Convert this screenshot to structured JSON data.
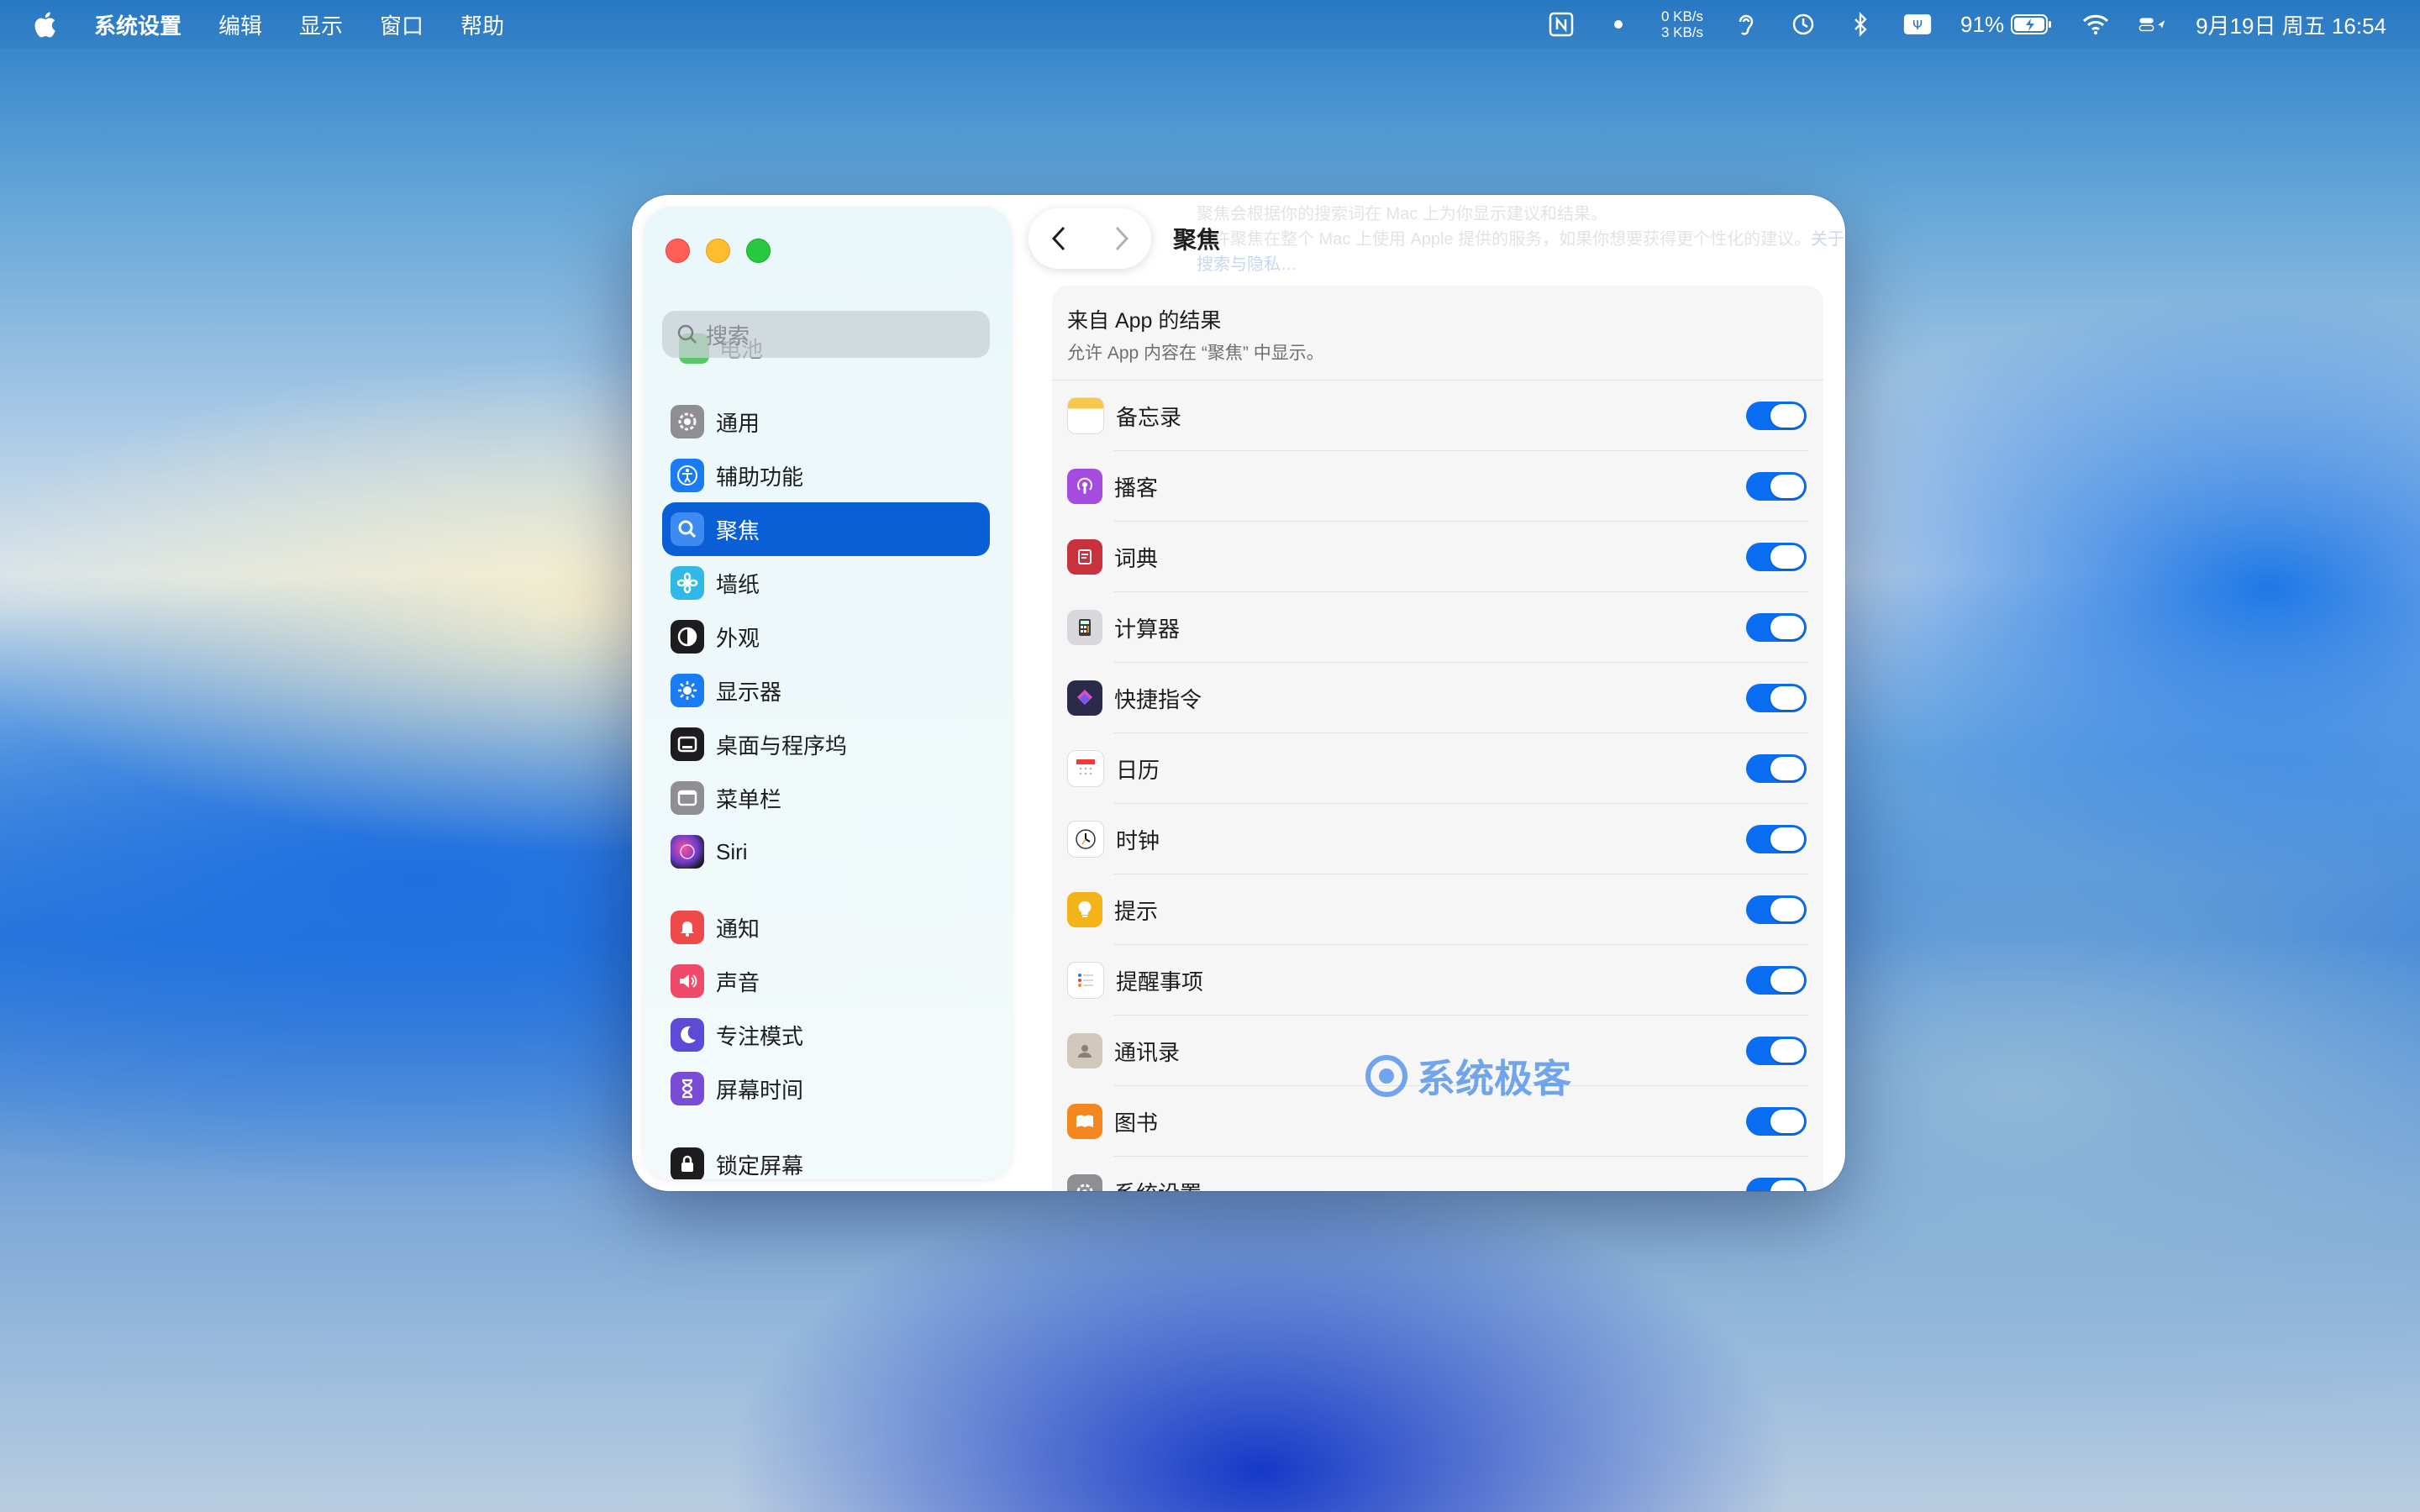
{
  "menubar": {
    "app_name": "系统设置",
    "menus": [
      "编辑",
      "显示",
      "窗口",
      "帮助"
    ],
    "net_down": "0 KB/s",
    "net_up": "3 KB/s",
    "battery_percent": "91%",
    "datetime": "9月19日 周五  16:54"
  },
  "sidebar": {
    "search_placeholder": "搜索",
    "partial_item": "电池",
    "groups": [
      [
        {
          "label": "通用",
          "icon": "gear-icon",
          "color": "#8e8e93"
        },
        {
          "label": "辅助功能",
          "icon": "accessibility-icon",
          "color": "#1a7cf5"
        },
        {
          "label": "聚焦",
          "icon": "magnifier-icon",
          "color": "#1a7cf5",
          "selected": true
        },
        {
          "label": "墙纸",
          "icon": "flower-icon",
          "color": "#30b8e8"
        },
        {
          "label": "外观",
          "icon": "appearance-icon",
          "color": "#1d1d1f"
        },
        {
          "label": "显示器",
          "icon": "sun-icon",
          "color": "#1a7cf5"
        },
        {
          "label": "桌面与程序坞",
          "icon": "dock-icon",
          "color": "#1d1d1f"
        },
        {
          "label": "菜单栏",
          "icon": "menubar-icon",
          "color": "#8e8e93"
        },
        {
          "label": "Siri",
          "icon": "siri-icon",
          "color": "#6a3cc9"
        }
      ],
      [
        {
          "label": "通知",
          "icon": "bell-icon",
          "color": "#ef4a4a"
        },
        {
          "label": "声音",
          "icon": "speaker-icon",
          "color": "#ef4a6a"
        },
        {
          "label": "专注模式",
          "icon": "moon-icon",
          "color": "#5b4bd6"
        },
        {
          "label": "屏幕时间",
          "icon": "hourglass-icon",
          "color": "#7a4bd6"
        }
      ],
      [
        {
          "label": "锁定屏幕",
          "icon": "lock-icon",
          "color": "#1d1d1f"
        }
      ]
    ]
  },
  "content": {
    "title": "聚焦",
    "faint_line1": "聚焦会根据你的搜索词在 Mac 上为你显示建议和结果。",
    "faint_line2": "允许聚焦在整个 Mac 上使用 Apple 提供的服务，如果你想要获得更个性化的建议。",
    "faint_link": "关于搜索与隐私…",
    "card_title": "来自 App 的结果",
    "card_subtitle": "允许 App 内容在 “聚焦” 中显示。",
    "apps": [
      {
        "label": "备忘录",
        "icon": "notes-icon",
        "color": "#f8c84a",
        "enabled": true
      },
      {
        "label": "播客",
        "icon": "podcasts-icon",
        "color": "#a54be0",
        "enabled": true
      },
      {
        "label": "词典",
        "icon": "dictionary-icon",
        "color": "#c8323c",
        "enabled": true
      },
      {
        "label": "计算器",
        "icon": "calculator-icon",
        "color": "#8e8e93",
        "enabled": true
      },
      {
        "label": "快捷指令",
        "icon": "shortcuts-icon",
        "color": "#5b3cc4",
        "enabled": true
      },
      {
        "label": "日历",
        "icon": "calendar-icon",
        "color": "#f2f2f2",
        "enabled": true
      },
      {
        "label": "时钟",
        "icon": "clock-icon",
        "color": "#f2f2f2",
        "enabled": true
      },
      {
        "label": "提示",
        "icon": "tips-icon",
        "color": "#f5b31a",
        "enabled": true
      },
      {
        "label": "提醒事项",
        "icon": "reminders-icon",
        "color": "#f2f2f2",
        "enabled": true
      },
      {
        "label": "通讯录",
        "icon": "contacts-icon",
        "color": "#b9b3a8",
        "enabled": true
      },
      {
        "label": "图书",
        "icon": "books-icon",
        "color": "#f5871f",
        "enabled": true
      },
      {
        "label": "系统设置",
        "icon": "settings-icon",
        "color": "#8e8e93",
        "enabled": true
      }
    ]
  },
  "watermark": "系统极客"
}
